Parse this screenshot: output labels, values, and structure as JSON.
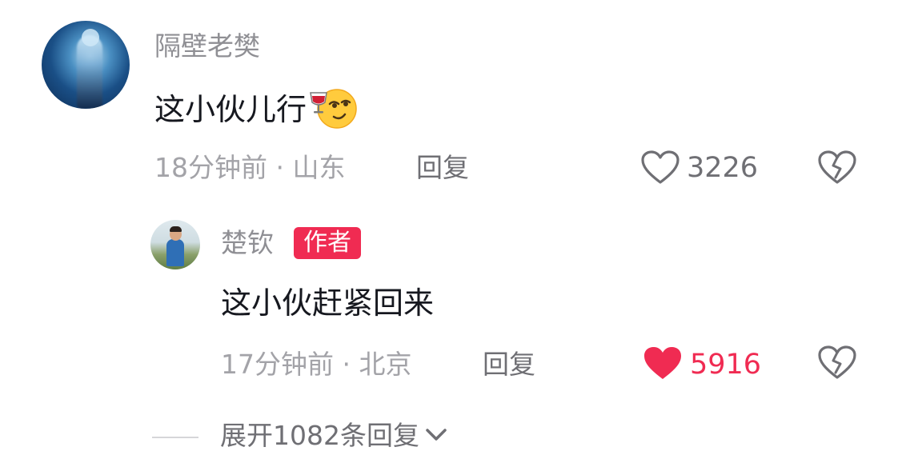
{
  "comment": {
    "username": "隔壁老樊",
    "text": "这小伙儿行",
    "emoji": "wine-toast-smirk-emoji",
    "time_location": "18分钟前 · 山东",
    "reply_label": "回复",
    "likes": "3226",
    "liked": false
  },
  "reply": {
    "username": "楚钦",
    "badge": "作者",
    "text": "这小伙赶紧回来",
    "time_location": "17分钟前 · 北京",
    "reply_label": "回复",
    "likes": "5916",
    "liked": true
  },
  "expand": {
    "label": "展开1082条回复"
  },
  "colors": {
    "accent": "#f02b52",
    "muted_text": "#8f8f94",
    "main_text": "#16181f",
    "icon": "#6f6f74"
  }
}
